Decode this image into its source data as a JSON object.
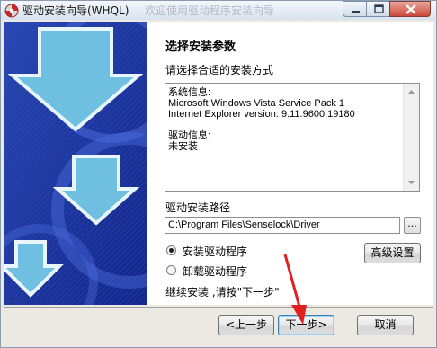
{
  "window": {
    "title": "驱动安装向导(WHQL)",
    "background_title": "欢迎使用驱动程序安装向导",
    "controls": {
      "minimize_icon": "minimize-icon",
      "maximize_icon": "maximize-icon",
      "close_icon": "close-icon"
    }
  },
  "page": {
    "heading": "选择安装参数",
    "prompt": "请选择合适的安装方式",
    "info_text": "系统信息:\nMicrosoft Windows Vista Service Pack 1\nInternet Explorer version: 9.11.9600.19180\n\n驱动信息:\n未安装",
    "path_label": "驱动安装路径",
    "path_value": "C:\\Program Files\\Senselock\\Driver",
    "browse_label": "...",
    "options": [
      {
        "label": "安装驱动程序",
        "selected": true
      },
      {
        "label": "卸载驱动程序",
        "selected": false
      }
    ],
    "advanced_label": "高级设置",
    "hint": "继续安装 ,请按\"下一步\""
  },
  "buttons": {
    "back": "<上一步",
    "next": "下一步>",
    "cancel": "取消"
  },
  "colors": {
    "sidebar_blue": "#1f3fa6",
    "sidebar_dark": "#0d1f6e",
    "arrow_fill": "#7dc9e6",
    "annotation_red": "#e02020"
  }
}
